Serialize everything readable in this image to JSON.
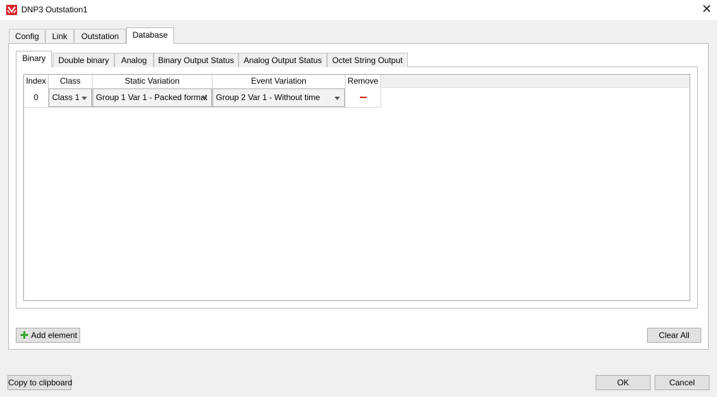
{
  "window": {
    "title": "DNP3 Outstation1",
    "app_icon": "dnp3-logo-icon",
    "close_glyph": "✕"
  },
  "outer_tabs": [
    {
      "label": "Config",
      "active": false
    },
    {
      "label": "Link",
      "active": false
    },
    {
      "label": "Outstation",
      "active": false
    },
    {
      "label": "Database",
      "active": true
    }
  ],
  "inner_tabs": [
    {
      "label": "Binary",
      "active": true
    },
    {
      "label": "Double binary",
      "active": false
    },
    {
      "label": "Analog",
      "active": false
    },
    {
      "label": "Binary Output Status",
      "active": false
    },
    {
      "label": "Analog Output Status",
      "active": false
    },
    {
      "label": "Octet String Output",
      "active": false
    }
  ],
  "table": {
    "columns": [
      "Index",
      "Class",
      "Static Variation",
      "Event Variation",
      "Remove"
    ],
    "rows": [
      {
        "index": "0",
        "class": "Class 1",
        "static_variation": "Group 1 Var 1 - Packed format",
        "event_variation": "Group 2 Var 1 - Without time",
        "remove_icon": "minus-icon"
      }
    ]
  },
  "buttons": {
    "add_element": "Add element",
    "clear_all": "Clear All",
    "copy_to_clipboard": "Copy to clipboard",
    "ok": "OK",
    "cancel": "Cancel"
  },
  "colors": {
    "remove_red": "#d9251c",
    "add_green": "#3aa935",
    "logo_red": "#d9252a"
  }
}
